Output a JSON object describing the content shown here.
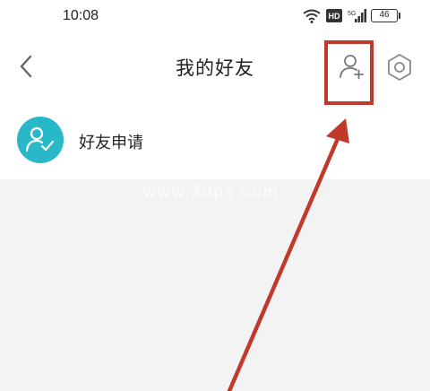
{
  "status_bar": {
    "time": "10:08",
    "hd_label": "HD",
    "network_label": "5G",
    "battery_level": "46",
    "icons": [
      "wifi-icon",
      "hd-icon",
      "signal-icon",
      "battery-icon"
    ]
  },
  "nav": {
    "title": "我的好友",
    "back_icon": "chevron-left-icon",
    "add_friend_icon": "add-user-icon",
    "settings_icon": "settings-hexagon-icon"
  },
  "friend_request": {
    "label": "好友申请",
    "icon": "user-check-icon",
    "icon_color": "#29b8c7"
  },
  "watermark": "www.3dps.com",
  "annotation": {
    "color": "#c0392b",
    "target": "add-friend-button"
  }
}
